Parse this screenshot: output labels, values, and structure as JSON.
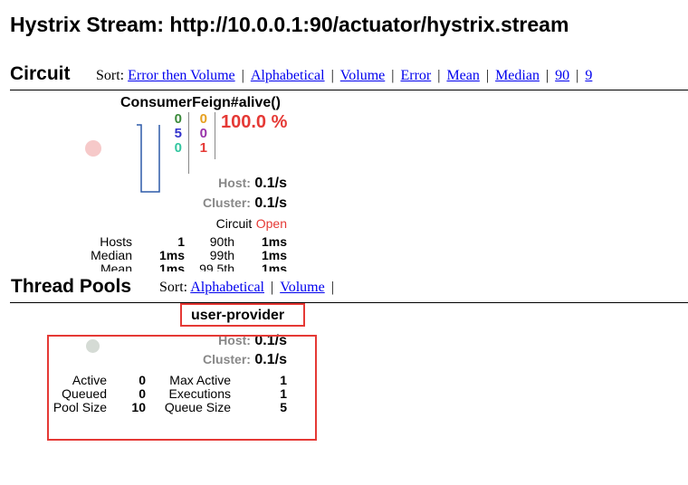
{
  "page": {
    "title": "Hystrix Stream: http://10.0.0.1:90/actuator/hystrix.stream"
  },
  "circuit_section": {
    "title": "Circuit",
    "sort_label": "Sort:",
    "sort_links": [
      "Error then Volume",
      "Alphabetical",
      "Volume",
      "Error",
      "Mean",
      "Median",
      "90",
      "9"
    ]
  },
  "circuit": {
    "name": "ConsumerFeign#alive()",
    "counts_left": [
      "0",
      "5",
      "0"
    ],
    "counts_right": [
      "0",
      "0",
      "1"
    ],
    "counts_colors": {
      "success": "#3a8a3a",
      "short_circuited": "#3333cc",
      "bad_request": "#33c6a0",
      "timeout": "#e6a020",
      "rejected": "#9933aa",
      "failure": "#e53935"
    },
    "error_pct": "100.0 %",
    "host_label": "Host:",
    "host_value": "0.1/s",
    "cluster_label": "Cluster:",
    "cluster_value": "0.1/s",
    "circuit_label": "Circuit",
    "circuit_status": "Open",
    "stats": [
      {
        "label": "Hosts",
        "value": "1",
        "p_label": "90th",
        "p_value": "1ms"
      },
      {
        "label": "Median",
        "value": "1ms",
        "p_label": "99th",
        "p_value": "1ms"
      },
      {
        "label": "Mean",
        "value": "1ms",
        "p_label": "99.5th",
        "p_value": "1ms"
      }
    ]
  },
  "thread_section": {
    "title": "Thread Pools",
    "sort_label": "Sort:",
    "sort_links": [
      "Alphabetical",
      "Volume"
    ]
  },
  "pool": {
    "name": "user-provider",
    "host_label": "Host:",
    "host_value": "0.1/s",
    "cluster_label": "Cluster:",
    "cluster_value": "0.1/s",
    "stats_left": [
      {
        "label": "Active",
        "value": "0"
      },
      {
        "label": "Queued",
        "value": "0"
      },
      {
        "label": "Pool Size",
        "value": "10"
      }
    ],
    "stats_right": [
      {
        "label": "Max Active",
        "value": "1"
      },
      {
        "label": "Executions",
        "value": "1"
      },
      {
        "label": "Queue Size",
        "value": "5"
      }
    ]
  }
}
